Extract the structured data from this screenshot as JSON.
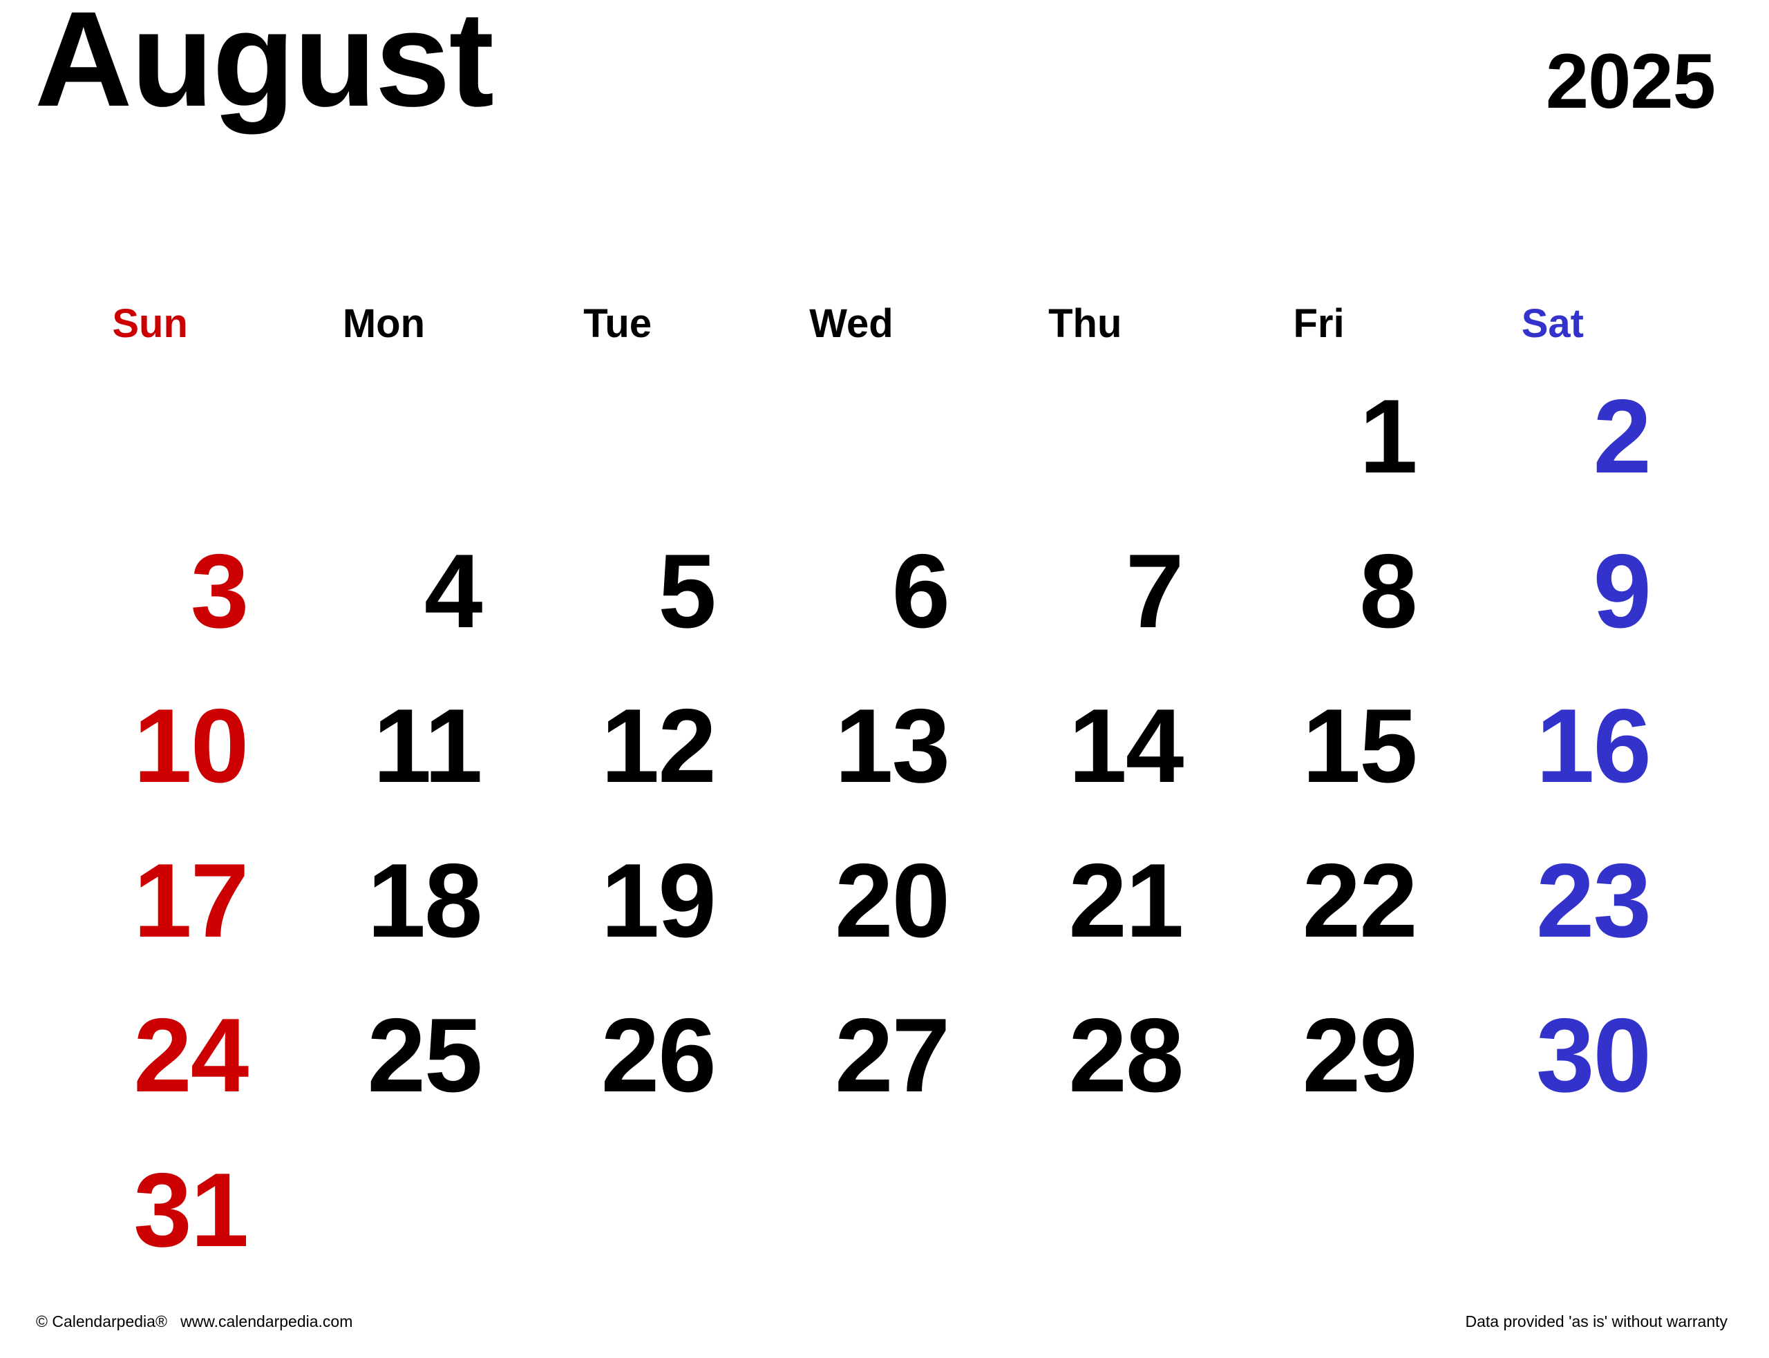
{
  "header": {
    "month": "August",
    "year": "2025"
  },
  "colors": {
    "sunday": "#cc0000",
    "saturday": "#3333cc",
    "weekday": "#000000",
    "background": "#ffffff"
  },
  "weekdays": [
    {
      "label": "Sun",
      "kind": "sun"
    },
    {
      "label": "Mon",
      "kind": "week"
    },
    {
      "label": "Tue",
      "kind": "week"
    },
    {
      "label": "Wed",
      "kind": "week"
    },
    {
      "label": "Thu",
      "kind": "week"
    },
    {
      "label": "Fri",
      "kind": "week"
    },
    {
      "label": "Sat",
      "kind": "sat"
    }
  ],
  "weeks": [
    [
      "",
      "",
      "",
      "",
      "",
      "1",
      "2"
    ],
    [
      "3",
      "4",
      "5",
      "6",
      "7",
      "8",
      "9"
    ],
    [
      "10",
      "11",
      "12",
      "13",
      "14",
      "15",
      "16"
    ],
    [
      "17",
      "18",
      "19",
      "20",
      "21",
      "22",
      "23"
    ],
    [
      "24",
      "25",
      "26",
      "27",
      "28",
      "29",
      "30"
    ],
    [
      "31",
      "",
      "",
      "",
      "",
      "",
      ""
    ]
  ],
  "footer": {
    "copyright": "© Calendarpedia®   www.calendarpedia.com",
    "disclaimer": "Data provided 'as is' without warranty"
  }
}
